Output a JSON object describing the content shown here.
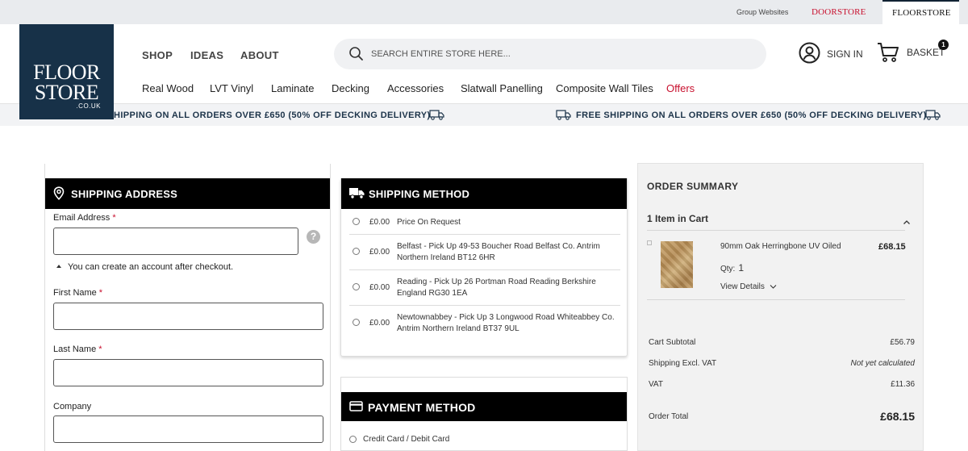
{
  "topbar": {
    "group_websites": "Group Websites",
    "doorstore": "DOORSTORE",
    "floorstore": "FLOORSTORE"
  },
  "logo": {
    "line1": "FLOOR",
    "line2": "STORE",
    "line3": ".CO.UK"
  },
  "main_nav": [
    "SHOP",
    "IDEAS",
    "ABOUT"
  ],
  "search": {
    "placeholder": "SEARCH ENTIRE STORE HERE..."
  },
  "account": {
    "sign_in": "SIGN IN",
    "basket": "BASKET",
    "basket_count": "1"
  },
  "sub_nav": [
    "Real Wood",
    "LVT Vinyl",
    "Laminate",
    "Decking",
    "Accessories",
    "Slatwall Panelling",
    "Composite Wall Tiles",
    "Offers"
  ],
  "banner": {
    "partial_text": "HIPPING ON ALL ORDERS OVER £650 (50% OFF DECKING DELIVERY)",
    "text": "FREE SHIPPING ON ALL ORDERS OVER £650 (50% OFF DECKING DELIVERY)"
  },
  "shipping_address": {
    "title": "SHIPPING ADDRESS",
    "email_label": "Email Address",
    "help": "?",
    "account_note": "You can create an account after checkout.",
    "first_name_label": "First Name",
    "last_name_label": "Last Name",
    "company_label": "Company",
    "required_mark": "*"
  },
  "shipping_method": {
    "title": "SHIPPING METHOD",
    "options": [
      {
        "price": "£0.00",
        "label": "Price On Request"
      },
      {
        "price": "£0.00",
        "label": "Belfast - Pick Up 49-53 Boucher Road Belfast Co. Antrim Northern Ireland BT12 6HR"
      },
      {
        "price": "£0.00",
        "label": "Reading - Pick Up 26 Portman Road Reading Berkshire England RG30 1EA"
      },
      {
        "price": "£0.00",
        "label": "Newtownabbey - Pick Up 3 Longwood Road Whiteabbey Co. Antrim Northern Ireland BT37 9UL"
      }
    ]
  },
  "payment_method": {
    "title": "PAYMENT METHOD",
    "options": [
      "Credit Card / Debit Card"
    ]
  },
  "order_summary": {
    "title": "ORDER SUMMARY",
    "items_header": "1 Item in Cart",
    "product": {
      "name": "90mm Oak Herringbone UV Oiled",
      "price": "£68.15",
      "qty_label": "Qty:",
      "qty": "1",
      "view_details": "View Details"
    },
    "totals": {
      "cart_subtotal_label": "Cart Subtotal",
      "cart_subtotal": "£56.79",
      "shipping_label": "Shipping Excl. VAT",
      "shipping": "Not yet calculated",
      "vat_label": "VAT",
      "vat": "£11.36",
      "order_total_label": "Order Total",
      "order_total": "£68.15"
    }
  },
  "colors": {
    "brand_navy": "#173148",
    "offer_red": "#c8102e",
    "header_black": "#000000"
  }
}
